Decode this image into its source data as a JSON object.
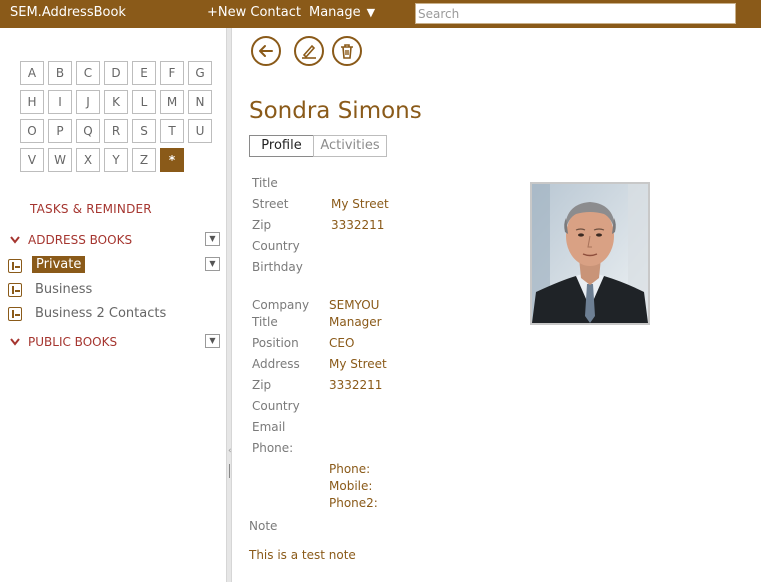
{
  "topbar": {
    "app_title": "SEM.AddressBook",
    "new_contact": "+New Contact",
    "manage": "Manage",
    "search_placeholder": "Search"
  },
  "sidebar": {
    "alphabet": [
      "A",
      "B",
      "C",
      "D",
      "E",
      "F",
      "G",
      "H",
      "I",
      "J",
      "K",
      "L",
      "M",
      "N",
      "O",
      "P",
      "Q",
      "R",
      "S",
      "T",
      "U",
      "V",
      "W",
      "X",
      "Y",
      "Z",
      "*"
    ],
    "active_letter": "*",
    "tasks": "TASKS & REMINDER",
    "address_books_header": "ADDRESS BOOKS",
    "books": [
      {
        "label": "Private",
        "selected": true
      },
      {
        "label": "Business",
        "selected": false
      },
      {
        "label": "Business 2 Contacts",
        "selected": false
      }
    ],
    "public_books_header": "PUBLIC BOOKS"
  },
  "contact": {
    "name": "Sondra Simons",
    "tabs": [
      "Profile",
      "Activities"
    ],
    "active_tab": "Profile",
    "personal": {
      "title_label": "Title",
      "street_label": "Street",
      "street": "My Street",
      "zip_label": "Zip",
      "zip": "3332211",
      "country_label": "Country",
      "birthday_label": "Birthday"
    },
    "business": {
      "company_label": "Company",
      "company": "SEMYOU",
      "title_label": "Title",
      "title": "Manager",
      "position_label": "Position",
      "position": "CEO",
      "address_label": "Address",
      "address": "My Street",
      "zip_label": "Zip",
      "zip": "3332211",
      "country_label": "Country",
      "email_label": "Email",
      "phone_label": "Phone:",
      "phone_sub": "Phone:",
      "mobile_sub": "Mobile:",
      "phone2_sub": "Phone2:"
    },
    "note_label": "Note",
    "note": "This is a test note"
  },
  "colors": {
    "brand": "#8a5a19",
    "section_text": "#a5352f",
    "label_text": "#7a7a7a"
  }
}
